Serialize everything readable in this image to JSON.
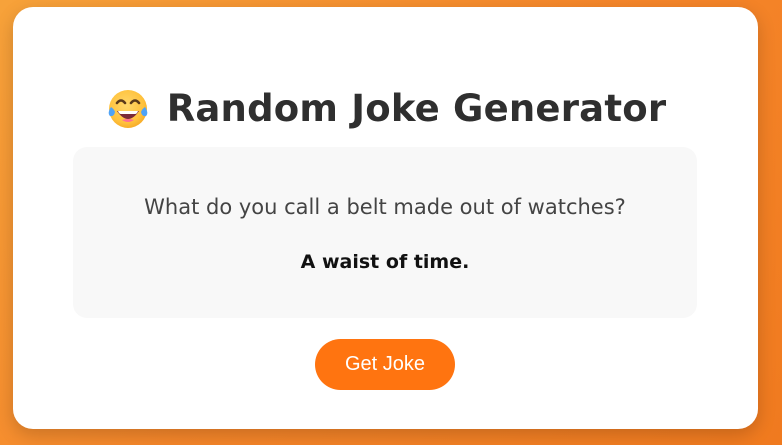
{
  "app": {
    "title": "Random Joke Generator",
    "title_icon": "face-with-tears-of-joy-icon"
  },
  "joke": {
    "setup": "What do you call a belt made out of watches?",
    "punchline": "A waist of time."
  },
  "actions": {
    "get_joke_label": "Get Joke"
  },
  "colors": {
    "background_gradient_start": "#f7a23a",
    "background_gradient_end": "#f07a1f",
    "card": "#ffffff",
    "joke_box": "#f8f8f8",
    "button": "#ff7410",
    "button_text": "#ffffff",
    "title_text": "#2f2f2f"
  }
}
